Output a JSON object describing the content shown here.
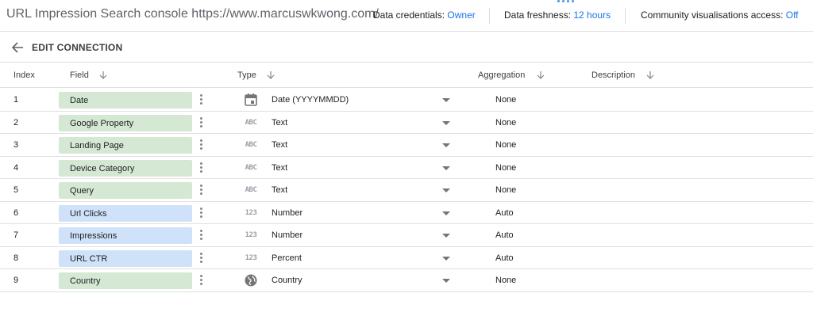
{
  "header": {
    "title": "URL Impression Search console https://www.marcuswkwong.com/",
    "credentials_label": "Data credentials: ",
    "credentials_value": "Owner",
    "freshness_label": "Data freshness: ",
    "freshness_value": "12 hours",
    "community_label": "Community visualisations access: ",
    "community_value": "Off"
  },
  "edit_bar": {
    "label": "EDIT CONNECTION",
    "back_icon": "arrow-left-icon"
  },
  "columns": {
    "index": "Index",
    "field": "Field",
    "type": "Type",
    "aggregation": "Aggregation",
    "description": "Description"
  },
  "colors": {
    "dimension_chip": "#d5e8d4",
    "metric_chip": "#cfe2f9",
    "accent": "#1a73e8"
  },
  "rows": [
    {
      "index": "1",
      "field": "Date",
      "kind": "dimension",
      "type_icon": "calendar-icon",
      "type": "Date (YYYYMMDD)",
      "aggregation": "None"
    },
    {
      "index": "2",
      "field": "Google Property",
      "kind": "dimension",
      "type_icon": "abc-icon",
      "type": "Text",
      "aggregation": "None"
    },
    {
      "index": "3",
      "field": "Landing Page",
      "kind": "dimension",
      "type_icon": "abc-icon",
      "type": "Text",
      "aggregation": "None"
    },
    {
      "index": "4",
      "field": "Device Category",
      "kind": "dimension",
      "type_icon": "abc-icon",
      "type": "Text",
      "aggregation": "None"
    },
    {
      "index": "5",
      "field": "Query",
      "kind": "dimension",
      "type_icon": "abc-icon",
      "type": "Text",
      "aggregation": "None"
    },
    {
      "index": "6",
      "field": "Url Clicks",
      "kind": "metric",
      "type_icon": "123-icon",
      "type": "Number",
      "aggregation": "Auto"
    },
    {
      "index": "7",
      "field": "Impressions",
      "kind": "metric",
      "type_icon": "123-icon",
      "type": "Number",
      "aggregation": "Auto"
    },
    {
      "index": "8",
      "field": "URL CTR",
      "kind": "metric",
      "type_icon": "123-icon",
      "type": "Percent",
      "aggregation": "Auto"
    },
    {
      "index": "9",
      "field": "Country",
      "kind": "dimension",
      "type_icon": "globe-icon",
      "type": "Country",
      "aggregation": "None"
    }
  ]
}
